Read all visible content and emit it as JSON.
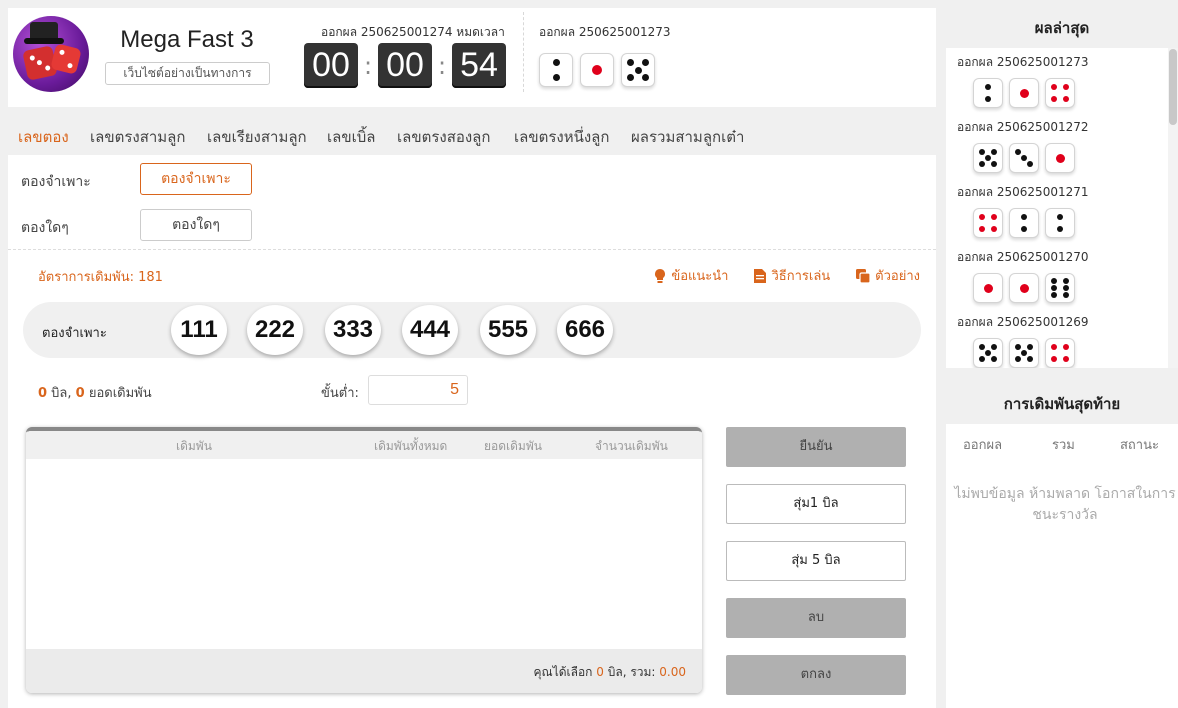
{
  "header": {
    "brand_title": "Mega Fast 3",
    "brand_subtitle": "เว็บไซต์อย่างเป็นทางการ",
    "current_draw_label": "ออกผล 250625001274 หมดเวลา",
    "timer": {
      "hours": "00",
      "minutes": "00",
      "seconds": "54",
      "separator": ":"
    },
    "previous_draw_label": "ออกผล 250625001273",
    "previous_dice": [
      2,
      1,
      5
    ]
  },
  "tabs": [
    {
      "label": "เลขตอง",
      "active": true
    },
    {
      "label": "เลขตรงสามลูก",
      "active": false
    },
    {
      "label": "เลขเรียงสามลูก",
      "active": false
    },
    {
      "label": "เลขเบิ้ล",
      "active": false
    },
    {
      "label": "เลขตรงสองลูก",
      "active": false
    },
    {
      "label": "เลขตรงหนึ่งลูก",
      "active": false
    },
    {
      "label": "ผลรวมสามลูกเต๋า",
      "active": false
    }
  ],
  "bet_modes": [
    {
      "row_label": "ตองจำเพาะ",
      "button_label": "ตองจำเพาะ",
      "active": true
    },
    {
      "row_label": "ตองใดๆ",
      "button_label": "ตองใดๆ",
      "active": false
    }
  ],
  "odds_label": "อัตราการเดิมพัน: 181",
  "help_links": [
    {
      "label": "ข้อแนะนำ",
      "icon": "lightbulb-icon"
    },
    {
      "label": "วิธีการเล่น",
      "icon": "document-icon"
    },
    {
      "label": "ตัวอย่าง",
      "icon": "copy-icon"
    }
  ],
  "choice": {
    "label": "ตองจำเพาะ",
    "numbers": [
      "111",
      "222",
      "333",
      "444",
      "555",
      "666"
    ]
  },
  "summary": {
    "bills_count": "0",
    "bills_text": " บิล, ",
    "bet_total": "0",
    "bet_text": " ยอดเดิมพัน"
  },
  "minimum": {
    "label": "ขั้นต่ำ:",
    "value": "5"
  },
  "bet_table": {
    "columns": [
      "เดิมพัน",
      "เดิมพันทั้งหมด",
      "ยอดเดิมพัน",
      "จำนวนเดิมพัน"
    ],
    "footer_prefix": "คุณได้เลือก ",
    "selected_count": "0",
    "footer_middle": " บิล, รวม: ",
    "selected_total": "0.00"
  },
  "actions": {
    "confirm": "ยืนยัน",
    "random_1": "สุ่ม1 บิล",
    "random_5": "สุ่ม 5 บิล",
    "delete": "ลบ",
    "ok": "ตกลง"
  },
  "latest_results": {
    "title": "ผลล่าสุด",
    "items": [
      {
        "label": "ออกผล 250625001273",
        "dice": [
          2,
          1,
          4
        ]
      },
      {
        "label": "ออกผล 250625001272",
        "dice": [
          5,
          3,
          1
        ]
      },
      {
        "label": "ออกผล 250625001271",
        "dice": [
          4,
          2,
          2
        ]
      },
      {
        "label": "ออกผล 250625001270",
        "dice": [
          1,
          1,
          6
        ]
      },
      {
        "label": "ออกผล 250625001269",
        "dice": [
          5,
          5,
          4
        ]
      }
    ]
  },
  "last_bets": {
    "title": "การเดิมพันสุดท้าย",
    "columns": [
      "ออกผล",
      "รวม",
      "สถานะ"
    ],
    "empty_message": "ไม่พบข้อมูล ห้ามพลาด โอกาสในการชนะรางวัล"
  },
  "colors": {
    "accent": "#d9651c",
    "die_red": "#e0001b",
    "die_black": "#111111",
    "timer_bg": "#333333"
  }
}
